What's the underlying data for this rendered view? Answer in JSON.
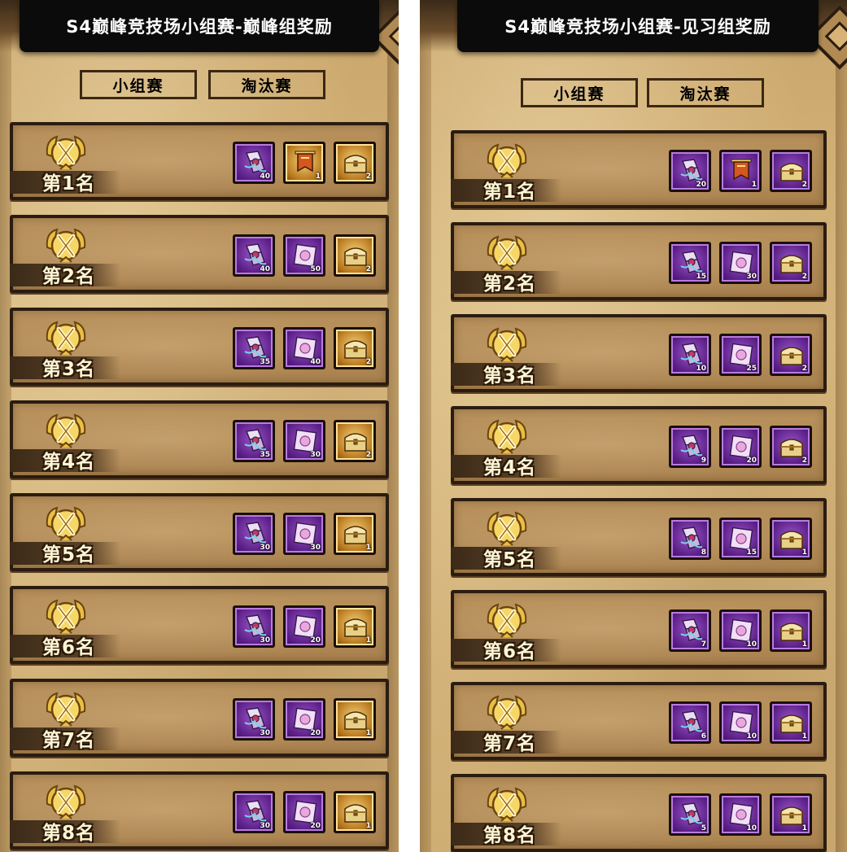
{
  "colors": {
    "purple_frame": "#5a1f86",
    "gold_frame": "#b8781e",
    "title_bg": "#0b0b0b"
  },
  "panels": [
    {
      "title": "S4巅峰竞技场小组赛-巅峰组奖励",
      "tabs": [
        {
          "label": "小组赛",
          "active": true
        },
        {
          "label": "淘汰赛",
          "active": false
        }
      ],
      "rows": [
        {
          "rank": "第1名",
          "items": [
            {
              "icon": "ribbon-scroll-icon",
              "frame": "purple",
              "count": "40"
            },
            {
              "icon": "banner-icon",
              "frame": "gold",
              "count": "1"
            },
            {
              "icon": "treasure-chest-icon",
              "frame": "gold",
              "count": "2"
            }
          ]
        },
        {
          "rank": "第2名",
          "items": [
            {
              "icon": "ribbon-scroll-icon",
              "frame": "purple",
              "count": "40"
            },
            {
              "icon": "card-icon",
              "frame": "purple",
              "count": "50"
            },
            {
              "icon": "treasure-chest-icon",
              "frame": "gold",
              "count": "2"
            }
          ]
        },
        {
          "rank": "第3名",
          "items": [
            {
              "icon": "ribbon-scroll-icon",
              "frame": "purple",
              "count": "35"
            },
            {
              "icon": "card-icon",
              "frame": "purple",
              "count": "40"
            },
            {
              "icon": "treasure-chest-icon",
              "frame": "gold",
              "count": "2"
            }
          ]
        },
        {
          "rank": "第4名",
          "items": [
            {
              "icon": "ribbon-scroll-icon",
              "frame": "purple",
              "count": "35"
            },
            {
              "icon": "card-icon",
              "frame": "purple",
              "count": "30"
            },
            {
              "icon": "treasure-chest-icon",
              "frame": "gold",
              "count": "2"
            }
          ]
        },
        {
          "rank": "第5名",
          "items": [
            {
              "icon": "ribbon-scroll-icon",
              "frame": "purple",
              "count": "30"
            },
            {
              "icon": "card-icon",
              "frame": "purple",
              "count": "30"
            },
            {
              "icon": "treasure-chest-icon",
              "frame": "gold",
              "count": "1"
            }
          ]
        },
        {
          "rank": "第6名",
          "items": [
            {
              "icon": "ribbon-scroll-icon",
              "frame": "purple",
              "count": "30"
            },
            {
              "icon": "card-icon",
              "frame": "purple",
              "count": "20"
            },
            {
              "icon": "treasure-chest-icon",
              "frame": "gold",
              "count": "1"
            }
          ]
        },
        {
          "rank": "第7名",
          "items": [
            {
              "icon": "ribbon-scroll-icon",
              "frame": "purple",
              "count": "30"
            },
            {
              "icon": "card-icon",
              "frame": "purple",
              "count": "20"
            },
            {
              "icon": "treasure-chest-icon",
              "frame": "gold",
              "count": "1"
            }
          ]
        },
        {
          "rank": "第8名",
          "items": [
            {
              "icon": "ribbon-scroll-icon",
              "frame": "purple",
              "count": "30"
            },
            {
              "icon": "card-icon",
              "frame": "purple",
              "count": "20"
            },
            {
              "icon": "treasure-chest-icon",
              "frame": "gold",
              "count": "1"
            }
          ]
        }
      ]
    },
    {
      "title": "S4巅峰竞技场小组赛-见习组奖励",
      "tabs": [
        {
          "label": "小组赛",
          "active": true
        },
        {
          "label": "淘汰赛",
          "active": false
        }
      ],
      "rows": [
        {
          "rank": "第1名",
          "items": [
            {
              "icon": "ribbon-scroll-icon",
              "frame": "purple",
              "count": "20"
            },
            {
              "icon": "banner-icon",
              "frame": "purple",
              "count": "1"
            },
            {
              "icon": "treasure-chest-icon",
              "frame": "purple",
              "count": "2"
            }
          ]
        },
        {
          "rank": "第2名",
          "items": [
            {
              "icon": "ribbon-scroll-icon",
              "frame": "purple",
              "count": "15"
            },
            {
              "icon": "card-icon",
              "frame": "purple",
              "count": "30"
            },
            {
              "icon": "treasure-chest-icon",
              "frame": "purple",
              "count": "2"
            }
          ]
        },
        {
          "rank": "第3名",
          "items": [
            {
              "icon": "ribbon-scroll-icon",
              "frame": "purple",
              "count": "10"
            },
            {
              "icon": "card-icon",
              "frame": "purple",
              "count": "25"
            },
            {
              "icon": "treasure-chest-icon",
              "frame": "purple",
              "count": "2"
            }
          ]
        },
        {
          "rank": "第4名",
          "items": [
            {
              "icon": "ribbon-scroll-icon",
              "frame": "purple",
              "count": "9"
            },
            {
              "icon": "card-icon",
              "frame": "purple",
              "count": "20"
            },
            {
              "icon": "treasure-chest-icon",
              "frame": "purple",
              "count": "2"
            }
          ]
        },
        {
          "rank": "第5名",
          "items": [
            {
              "icon": "ribbon-scroll-icon",
              "frame": "purple",
              "count": "8"
            },
            {
              "icon": "card-icon",
              "frame": "purple",
              "count": "15"
            },
            {
              "icon": "treasure-chest-icon",
              "frame": "purple",
              "count": "1"
            }
          ]
        },
        {
          "rank": "第6名",
          "items": [
            {
              "icon": "ribbon-scroll-icon",
              "frame": "purple",
              "count": "7"
            },
            {
              "icon": "card-icon",
              "frame": "purple",
              "count": "10"
            },
            {
              "icon": "treasure-chest-icon",
              "frame": "purple",
              "count": "1"
            }
          ]
        },
        {
          "rank": "第7名",
          "items": [
            {
              "icon": "ribbon-scroll-icon",
              "frame": "purple",
              "count": "6"
            },
            {
              "icon": "card-icon",
              "frame": "purple",
              "count": "10"
            },
            {
              "icon": "treasure-chest-icon",
              "frame": "purple",
              "count": "1"
            }
          ]
        },
        {
          "rank": "第8名",
          "items": [
            {
              "icon": "ribbon-scroll-icon",
              "frame": "purple",
              "count": "5"
            },
            {
              "icon": "card-icon",
              "frame": "purple",
              "count": "10"
            },
            {
              "icon": "treasure-chest-icon",
              "frame": "purple",
              "count": "1"
            }
          ]
        }
      ]
    }
  ]
}
